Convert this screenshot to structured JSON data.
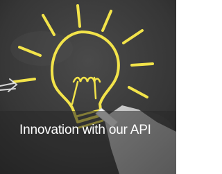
{
  "tile": {
    "caption": "Innovation with our API"
  },
  "image": {
    "subject": "chalk-drawn lightbulb on chalkboard with hand holding chalk",
    "colors": {
      "board": "#3a3a3a",
      "chalk_yellow": "#f2e34a",
      "chalk_white": "#e8e8e8",
      "overlay": "#2a2a2a"
    }
  }
}
